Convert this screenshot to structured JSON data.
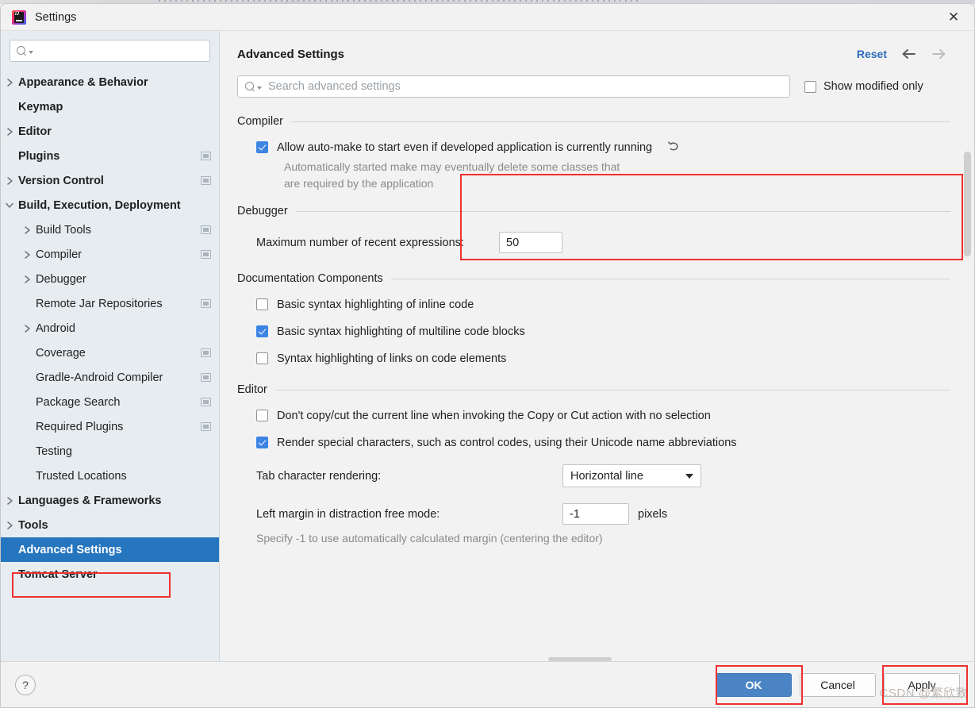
{
  "window": {
    "title": "Settings",
    "app_icon": "intellij-idea-icon",
    "close_icon": "close-icon"
  },
  "sidebar": {
    "search": {
      "placeholder": "",
      "value": "",
      "icon": "search-icon"
    },
    "items": [
      {
        "label": "Appearance & Behavior",
        "level": 0,
        "bold": true,
        "arrow": "collapsed",
        "badge": false
      },
      {
        "label": "Keymap",
        "level": 0,
        "bold": true,
        "arrow": "none",
        "badge": false
      },
      {
        "label": "Editor",
        "level": 0,
        "bold": true,
        "arrow": "collapsed",
        "badge": false
      },
      {
        "label": "Plugins",
        "level": 0,
        "bold": true,
        "arrow": "none",
        "badge": true
      },
      {
        "label": "Version Control",
        "level": 0,
        "bold": true,
        "arrow": "collapsed",
        "badge": true
      },
      {
        "label": "Build, Execution, Deployment",
        "level": 0,
        "bold": true,
        "arrow": "expanded",
        "badge": false
      },
      {
        "label": "Build Tools",
        "level": 1,
        "bold": false,
        "arrow": "collapsed",
        "badge": true
      },
      {
        "label": "Compiler",
        "level": 1,
        "bold": false,
        "arrow": "collapsed",
        "badge": true
      },
      {
        "label": "Debugger",
        "level": 1,
        "bold": false,
        "arrow": "collapsed",
        "badge": false
      },
      {
        "label": "Remote Jar Repositories",
        "level": 1,
        "bold": false,
        "arrow": "none",
        "badge": true
      },
      {
        "label": "Android",
        "level": 1,
        "bold": false,
        "arrow": "collapsed",
        "badge": false
      },
      {
        "label": "Coverage",
        "level": 1,
        "bold": false,
        "arrow": "none",
        "badge": true
      },
      {
        "label": "Gradle-Android Compiler",
        "level": 1,
        "bold": false,
        "arrow": "none",
        "badge": true
      },
      {
        "label": "Package Search",
        "level": 1,
        "bold": false,
        "arrow": "none",
        "badge": true
      },
      {
        "label": "Required Plugins",
        "level": 1,
        "bold": false,
        "arrow": "none",
        "badge": true
      },
      {
        "label": "Testing",
        "level": 1,
        "bold": false,
        "arrow": "none",
        "badge": false
      },
      {
        "label": "Trusted Locations",
        "level": 1,
        "bold": false,
        "arrow": "none",
        "badge": false
      },
      {
        "label": "Languages & Frameworks",
        "level": 0,
        "bold": true,
        "arrow": "collapsed",
        "badge": false
      },
      {
        "label": "Tools",
        "level": 0,
        "bold": true,
        "arrow": "collapsed",
        "badge": false
      },
      {
        "label": "Advanced Settings",
        "level": 0,
        "bold": true,
        "arrow": "none",
        "badge": false,
        "selected": true
      },
      {
        "label": "Tomcat Server",
        "level": 0,
        "bold": true,
        "arrow": "none",
        "badge": false
      }
    ]
  },
  "content": {
    "title": "Advanced Settings",
    "reset_label": "Reset",
    "back_icon": "arrow-left-icon",
    "forward_icon": "arrow-right-icon",
    "search": {
      "placeholder": "Search advanced settings",
      "value": "",
      "icon": "search-icon"
    },
    "show_modified_only": {
      "label": "Show modified only",
      "checked": false
    },
    "groups": [
      {
        "title": "Compiler",
        "options": [
          {
            "type": "checkbox",
            "label": "Allow auto-make to start even if developed application is currently running",
            "checked": true,
            "revert_icon": "revert-icon",
            "description": "Automatically started make may eventually delete some classes that are required by the application"
          }
        ]
      },
      {
        "title": "Debugger",
        "options": [
          {
            "type": "text-field",
            "label": "Maximum number of recent expressions:",
            "value": "50"
          }
        ]
      },
      {
        "title": "Documentation Components",
        "options": [
          {
            "type": "checkbox",
            "label": "Basic syntax highlighting of inline code",
            "checked": false
          },
          {
            "type": "checkbox",
            "label": "Basic syntax highlighting of multiline code blocks",
            "checked": true
          },
          {
            "type": "checkbox",
            "label": "Syntax highlighting of links on code elements",
            "checked": false
          }
        ]
      },
      {
        "title": "Editor",
        "options": [
          {
            "type": "checkbox",
            "label": "Don't copy/cut the current line when invoking the Copy or Cut action with no selection",
            "checked": false
          },
          {
            "type": "checkbox",
            "label": "Render special characters, such as control codes, using their Unicode name abbreviations",
            "checked": true
          },
          {
            "type": "combo",
            "label": "Tab character rendering:",
            "value": "Horizontal line"
          },
          {
            "type": "text-field",
            "label": "Left margin in distraction free mode:",
            "value": "-1",
            "unit": "pixels",
            "description": "Specify -1 to use automatically calculated margin (centering the editor)"
          }
        ]
      }
    ]
  },
  "footer": {
    "help_label": "?",
    "ok_label": "OK",
    "cancel_label": "Cancel",
    "apply_label": "Apply"
  },
  "watermark": "CSDN @繁欣致",
  "colors": {
    "accent_blue": "#2675bf",
    "primary_button": "#4b84c4",
    "link_blue": "#2b6cb8",
    "annotation_red": "#f03030",
    "sidebar_bg": "#e7ecf0",
    "content_bg": "#f2f2f2",
    "checkbox_checked": "#3b84e3"
  }
}
